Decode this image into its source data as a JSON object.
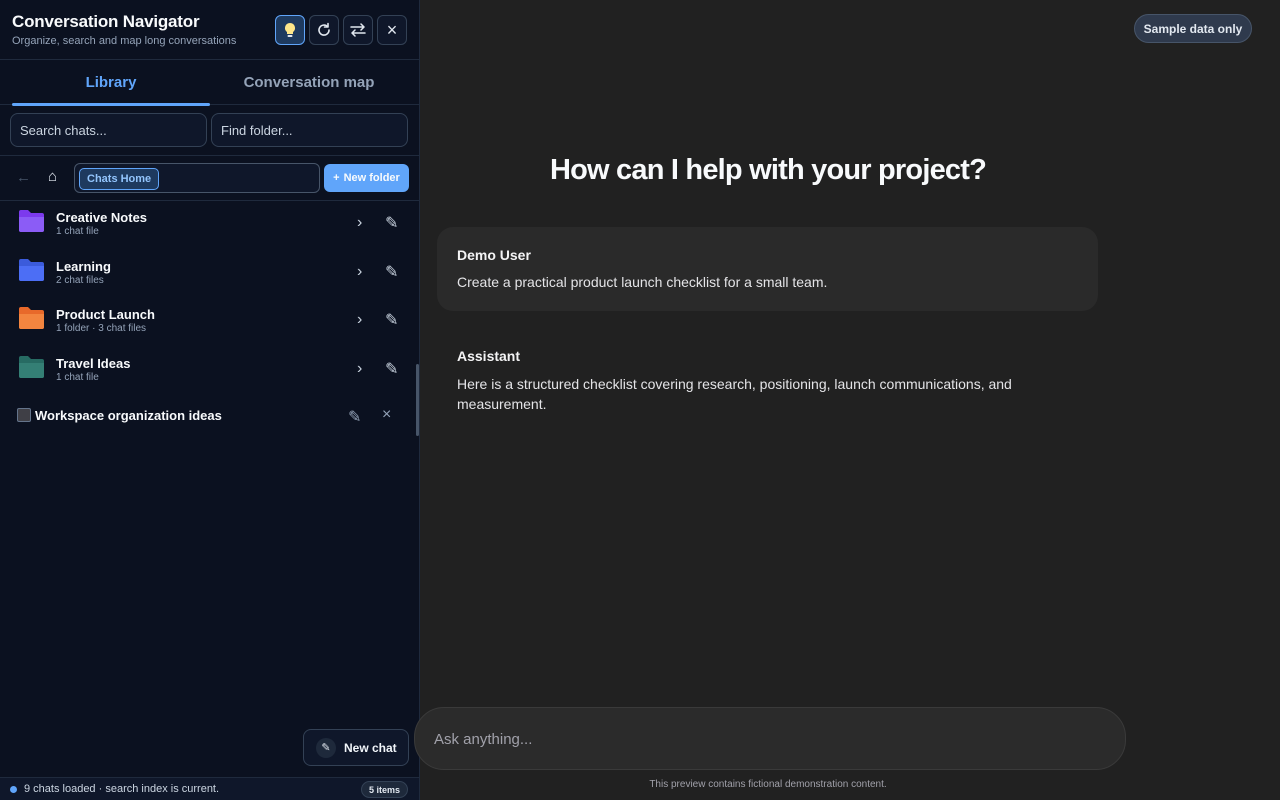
{
  "sidebar": {
    "title": "Conversation Navigator",
    "subtitle": "Organize, search and map long conversations",
    "header_buttons": [
      {
        "name": "lightbulb-icon",
        "state": "active"
      },
      {
        "name": "refresh-icon"
      },
      {
        "name": "swap-icon"
      },
      {
        "name": "close-icon",
        "glyph": "×"
      }
    ],
    "tabs": [
      {
        "label": "Library",
        "active": true
      },
      {
        "label": "Conversation map",
        "active": false
      }
    ],
    "search_chats_placeholder": "Search chats...",
    "find_folder_placeholder": "Find folder...",
    "path": {
      "back_glyph": "←",
      "home_glyph": "⌂",
      "crumb": "Chats Home",
      "new_folder_label": "New folder",
      "new_folder_glyph": "+"
    },
    "folders": [
      {
        "name": "Creative Notes",
        "meta": "1 chat file",
        "color": "#7c3aed"
      },
      {
        "name": "Learning",
        "meta": "2 chat files",
        "color": "#3b5bdb"
      },
      {
        "name": "Product Launch",
        "meta": "1 folder · 3 chat files",
        "color": "#f07a33"
      },
      {
        "name": "Travel Ideas",
        "meta": "1 chat file",
        "color": "#2f7d73"
      }
    ],
    "chevron_glyph": "›",
    "pencil_glyph": "✎",
    "note": {
      "label": "Workspace organization ideas",
      "close_glyph": "×"
    },
    "new_chat_label": "New chat",
    "status": {
      "text": "9 chats loaded · search index is current.",
      "items": "5 items"
    }
  },
  "main": {
    "sample_badge": "Sample data only",
    "hero": "How can I help with your project?",
    "messages": [
      {
        "author": "Demo User",
        "text": "Create a practical product launch checklist for a small team."
      },
      {
        "author": "Assistant",
        "text": "Here is a structured checklist covering research, positioning, launch communications, and measurement."
      }
    ],
    "composer_placeholder": "Ask anything...",
    "footer_note": "This preview contains fictional demonstration content."
  },
  "colors": {
    "accent": "#60a5fa",
    "sidebar_bg": "#0b1120",
    "main_bg": "#212121"
  }
}
